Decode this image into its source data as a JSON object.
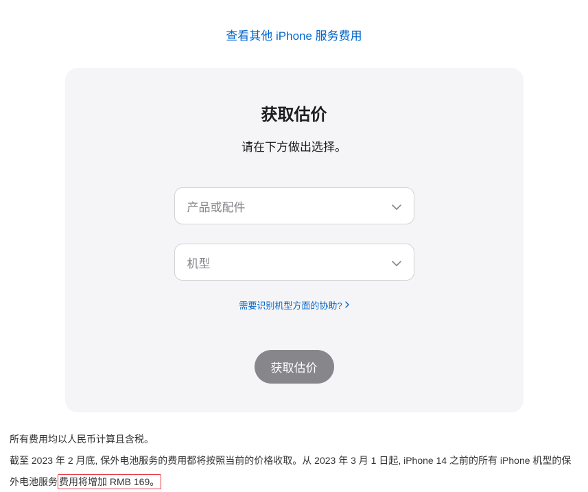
{
  "top_link": {
    "label": "查看其他 iPhone 服务费用"
  },
  "card": {
    "title": "获取估价",
    "subtitle": "请在下方做出选择。",
    "selects": {
      "product_placeholder": "产品或配件",
      "model_placeholder": "机型"
    },
    "identify_help": "需要识别机型方面的协助?",
    "cta_label": "获取估价"
  },
  "footnotes": {
    "line1": "所有费用均以人民币计算且含税。",
    "line2_prefix": "截至 2023 年 2 月底, 保外电池服务的费用都将按照当前的价格收取。从 2023 年 3 月 1 日起, iPhone 14 之前的所有 iPhone 机型的保外电池服务",
    "line2_mark": "费用将增加 RMB 169。"
  }
}
